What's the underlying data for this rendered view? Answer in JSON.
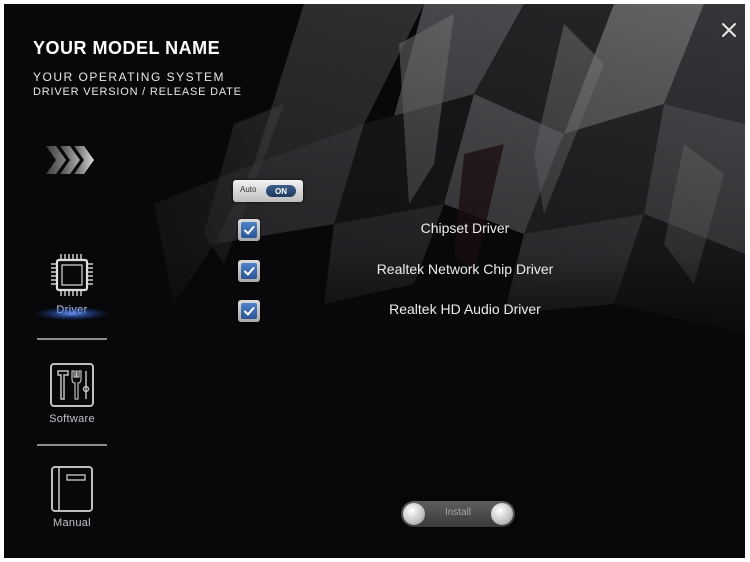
{
  "header": {
    "model_name": "YOUR MODEL NAME",
    "operating_system": "YOUR OPERATING SYSTEM",
    "driver_version_line": "DRIVER VERSION / RELEASE DATE",
    "close_icon": "close-icon"
  },
  "sidebar": {
    "items": [
      {
        "label": "Driver",
        "icon": "chip-icon",
        "active": true
      },
      {
        "label": "Software",
        "icon": "tools-icon",
        "active": false
      },
      {
        "label": "Manual",
        "icon": "manual-icon",
        "active": false
      }
    ]
  },
  "auto_toggle": {
    "label": "Auto",
    "state": "ON"
  },
  "drivers": [
    {
      "name": "Chipset Driver",
      "checked": true
    },
    {
      "name": "Realtek Network Chip Driver",
      "checked": true
    },
    {
      "name": "Realtek HD Audio Driver",
      "checked": true
    }
  ],
  "install_button": {
    "label": "Install"
  },
  "colors": {
    "background": "#08080a",
    "accent_blue": "#3a6cb4",
    "text": "#e6e6e6"
  }
}
